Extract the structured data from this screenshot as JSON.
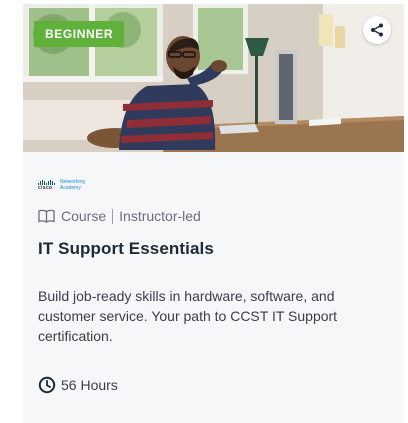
{
  "card": {
    "badge": "BEGINNER",
    "share_icon": "share-icon",
    "logo": {
      "word": "cisco",
      "line1": "Networking",
      "line2": "Academy"
    },
    "type": "Course",
    "type_icon": "book-icon",
    "delivery": "Instructor-led",
    "title": "IT Support Essentials",
    "description": "Build job-ready skills in hardware, software, and customer service. Your path to CCST IT Support certification.",
    "duration_icon": "clock-icon",
    "duration": "56 Hours"
  },
  "colors": {
    "badge_bg": "#5fb13b",
    "title": "#1e2a36",
    "meta": "#6b7077",
    "card_bg": "#f6f7f8"
  }
}
